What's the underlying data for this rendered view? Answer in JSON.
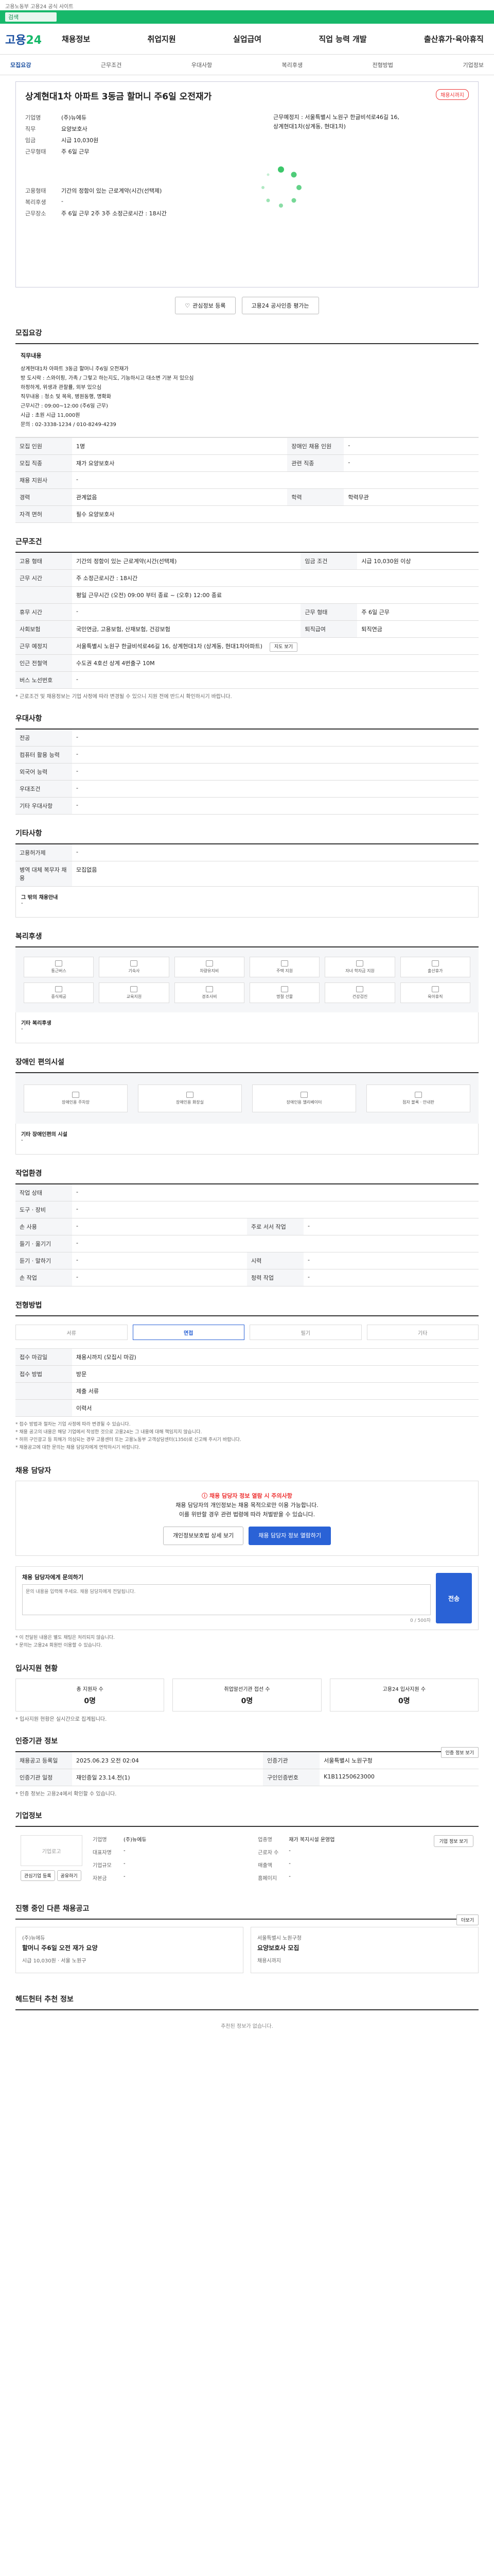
{
  "notice": "고용노동부 고용24 공식 사이트",
  "search_chip": "검색",
  "gnb": {
    "logo_a": "고용",
    "logo_b": "24",
    "menu": [
      "채용정보",
      "취업지원",
      "실업급여",
      "직업 능력 개발",
      "출산휴가·육아휴직"
    ]
  },
  "tabs": [
    "모집요강",
    "근무조건",
    "우대사항",
    "복리후생",
    "전형방법",
    "기업정보"
  ],
  "summary": {
    "title": "상계현대1차 아파트 3동금 할머니 주6일 오전재가",
    "badge": "채용시까지",
    "company_k": "기업명",
    "company_v": "(주)뉴에듀",
    "job_k": "직무",
    "job_v": "요양보호사",
    "pay_k": "임금",
    "pay_v": "시급 10,030원",
    "worktype_k": "근무형태",
    "worktype_v": "주 6일 근무",
    "right_1": "근무예정지 : 서울특별시 노원구 한글비석로46길 16,",
    "right_2": "상계현대1차(상계동, 현대1차)",
    "cond_k": "고용형태",
    "cond_v": "기간의 정함이 있는 근로계약(시간(선택제)",
    "welfare_k": "복리후생",
    "addr_k": "근무장소",
    "addr_v": "주 6일 근무 2주 3주 소정근로시간 : 18시간",
    "btn_interest": "관심정보 등록",
    "btn_share": "고용24 공사인증 평가는"
  },
  "recruit": {
    "title": "모집요강",
    "desc_k": "직무내용",
    "desc_lines": [
      "상계현대1차 아파트 3동금 할머니 주6일 오전재가",
      "방 도시락 : 스와이핑, 가족 / 그렇고 하는지도, 기능하시고 대소변 기분 저 있으심",
      "하정하게, 위생과 관찰률, 외부 있으심",
      "직무내용 : 청소 및 목욕, 병원동행, 명확화",
      "근무시간 : 09:00~12:00 (주6일 근무)",
      "시급 : 초원 시급 11,000원",
      "문의 : 02-3338-1234 / 010-8249-4239"
    ],
    "rows": [
      {
        "k": "모집 인원",
        "v": "1명",
        "k2": "장애인 채용 인원",
        "v2": "-"
      },
      {
        "k": "모집 직종",
        "v": "재가 요양보호사",
        "k2": "관련 직종",
        "v2": "-"
      },
      {
        "k": "채용 지원사",
        "v": "-",
        "k2": "",
        "v2": ""
      },
      {
        "k": "경력",
        "v": "관계없음",
        "k2": "학력",
        "v2": "학력무관"
      },
      {
        "k": "자격 면허",
        "v": "필수 요양보호사",
        "k2": "",
        "v2": ""
      }
    ]
  },
  "conditions": {
    "title": "근무조건",
    "rows": [
      {
        "k": "고용 형태",
        "v": "기간의 정함이 있는 근로계약(시간(선택제)",
        "k2": "임금 조건",
        "v2": "시급 10,030원 이상"
      },
      {
        "k": "근무 시간",
        "v": "주 소정근로시간 : 18시간",
        "k2": "",
        "v2": ""
      },
      {
        "k": "",
        "v": "평일 근무시간 (오전) 09:00 부터 종료 ~ (오후) 12:00 종료",
        "k2": "",
        "v2": ""
      },
      {
        "k": "휴무 시간",
        "v": "-",
        "k2": "근무 형태",
        "v2": "주 6일 근무"
      },
      {
        "k": "사회보험",
        "v": "국민연금, 고용보험, 산재보험, 건강보험",
        "k2": "퇴직급여",
        "v2": "퇴직연금"
      },
      {
        "k": "근무 예정지",
        "v": "서울특별시 노원구 한글비석로46길 16, 상계현대1차 (상계동, 현대1차아파트)",
        "k2": "",
        "v2": ""
      },
      {
        "k": "인근 전철역",
        "v": "수도권 4호선 상계 4번출구 10M",
        "k2": "",
        "v2": ""
      },
      {
        "k": "버스 노선번호",
        "v": "-",
        "k2": "",
        "v2": ""
      }
    ],
    "map_btn": "지도 보기",
    "note": "* 근로조건 및 채용정보는 기업 사정에 따라 변경될 수 있으니 지원 전에 반드시 확인하시기 바랍니다."
  },
  "preferred": {
    "title": "우대사항",
    "rows": [
      {
        "k": "전공",
        "v": "-"
      },
      {
        "k": "컴퓨터 활용 능력",
        "v": "-"
      },
      {
        "k": "외국어 능력",
        "v": "-"
      },
      {
        "k": "우대조건",
        "v": "-"
      },
      {
        "k": "기타 우대사항",
        "v": "-"
      }
    ]
  },
  "etc": {
    "title": "기타사항",
    "rows": [
      {
        "k": "고용허가제",
        "v": "-"
      },
      {
        "k": "병역 대체 복무자 채용",
        "v": "모집없음"
      }
    ],
    "sub_k": "그 밖의 채용안내",
    "sub_v": "-"
  },
  "welfare": {
    "title": "복리후생",
    "items": [
      "통근버스",
      "기숙사",
      "차량유지비",
      "주택 지원",
      "자녀 학자금 지원",
      "출산휴가",
      "중식제공",
      "교육지원",
      "경조사비",
      "명절 선물",
      "건강검진",
      "육아휴직"
    ],
    "sub_k": "기타 복리후생",
    "sub_v": "-"
  },
  "disabled": {
    "title": "장애인 편의시설",
    "items": [
      "장애인용 주차장",
      "장애인용 화장실",
      "장애인용 엘리베이터",
      "점자 블록 · 안내판"
    ],
    "sub_k": "기타 장애인편의 시설",
    "sub_v": "-"
  },
  "env": {
    "title": "작업환경",
    "rows": [
      {
        "k": "작업 상태",
        "v": "-",
        "k2": "",
        "v2": ""
      },
      {
        "k": "도구 · 장비",
        "v": "-",
        "k2": "",
        "v2": ""
      },
      {
        "k": "손 사용",
        "v": "-",
        "k2": "주로 서서 작업",
        "v2": "-"
      },
      {
        "k": "들기 · 옮기기",
        "v": "-",
        "k2": "",
        "v2": ""
      },
      {
        "k": "듣기 · 말하기",
        "v": "-",
        "k2": "시력",
        "v2": "-"
      },
      {
        "k": "손 작업",
        "v": "-",
        "k2": "청력 작업",
        "v2": "-"
      }
    ]
  },
  "process": {
    "title": "전형방법",
    "steps": [
      "서류",
      "면접",
      "필기",
      "기타"
    ],
    "rows": [
      {
        "k": "접수 마감일",
        "v": "채용시까지 (모집시 마감)"
      },
      {
        "k": "접수 방법",
        "v": "방문"
      },
      {
        "k": "",
        "v": "제출 서류"
      },
      {
        "k": "",
        "v": "이력서"
      }
    ],
    "notes": [
      "* 접수 방법과 절차는 기업 사정에 따라 변경될 수 있습니다.",
      "* 채용 공고의 내용은 해당 기업에서 작성한 것으로 고용24는 그 내용에 대해 책임지지 않습니다.",
      "* 허위 구인광고 등 피해가 의심되는 경우 고용센터 또는 고용노동부 고객상담센터(1350)로 신고해 주시기 바랍니다.",
      "* 채용공고에 대한 문의는 채용 담당자에게 연락하시기 바랍니다."
    ]
  },
  "manager": {
    "title": "채용 담당자",
    "warn": "채용 담당자 정보 열람 시 주의사항",
    "line1": "채용 담당자의 개인정보는 채용 목적으로만 이용 가능합니다.",
    "line2": "이를 위반할 경우 관련 법령에 따라 처벌받을 수 있습니다.",
    "btn1": "개인정보보호법 상세 보기",
    "btn2": "채용 담당자 정보 열람하기"
  },
  "inquiry": {
    "title": "채용 담당자에게 문의하기",
    "placeholder": "문의 내용을 입력해 주세요. 채용 담당자에게 전달됩니다.",
    "count": "0 / 500자",
    "send": "전송",
    "notes": [
      "* 이 전달된 내용은 별도 채팅은 처리되지 않습니다.",
      "* 문의는 고용24 회원만 이용할 수 있습니다."
    ]
  },
  "applicants": {
    "title": "입사지원 현황",
    "items": [
      {
        "label": "총 지원자 수",
        "value": "0명"
      },
      {
        "label": "취업알선기관 접선 수",
        "value": "0명"
      },
      {
        "label": "고용24 입사지원 수",
        "value": "0명"
      }
    ],
    "note": "* 입사지원 현황은 실시간으로 집계됩니다."
  },
  "info": {
    "title": "인증기관 정보",
    "btn": "인증 정보 보기",
    "rows": [
      {
        "k": "채용공고 등록일",
        "v": "2025.06.23 오전 02:04",
        "k2": "인증기관",
        "v2": "서울특별시 노원구청"
      },
      {
        "k": "인증기관 일정",
        "v": "재인증일 23.14.전(1)",
        "k2": "구인인증번호",
        "v2": "K1B11250623000"
      }
    ],
    "notes": [
      "* 인증 정보는 고용24에서 확인할 수 있습니다."
    ]
  },
  "company": {
    "title": "기업정보",
    "logo": "기업로고",
    "btn": "기업 정보 보기",
    "btn_interest": "관심기업 등록",
    "btn_share": "공유하기",
    "grid": [
      {
        "k": "기업명",
        "v": "(주)뉴에듀"
      },
      {
        "k": "업종명",
        "v": "재가 복지시설 운영업"
      },
      {
        "k": "대표자명",
        "v": "-"
      },
      {
        "k": "근로자 수",
        "v": "-"
      },
      {
        "k": "기업규모",
        "v": "-"
      },
      {
        "k": "매출액",
        "v": "-"
      },
      {
        "k": "자본금",
        "v": "-"
      },
      {
        "k": "홈페이지",
        "v": "-"
      }
    ]
  },
  "related": {
    "title": "진행 중인 다른 채용공고",
    "btn": "더보기",
    "card1_tag": "(주)뉴에듀",
    "card1_title": "할머니 주6일 오전 재가 요양",
    "card1_meta": "시급 10,030원 · 서울 노원구",
    "card2_tag": "서울특별시 노원구청",
    "card2_title": "요양보호사 모집",
    "card2_meta": "채용시까지"
  },
  "hr": {
    "title": "헤드헌터 추천 정보",
    "empty": "추천된 정보가 없습니다."
  }
}
